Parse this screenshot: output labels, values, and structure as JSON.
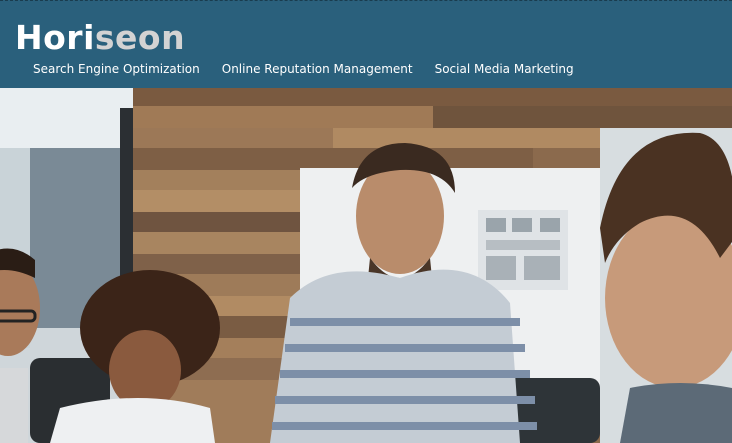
{
  "header": {
    "logo": {
      "part1": "Hori",
      "part2": "seon",
      "part2_color": "#d3d3d3"
    },
    "background_color": "#2a607c",
    "nav": [
      {
        "label": "Search Engine Optimization"
      },
      {
        "label": "Online Reputation Management"
      },
      {
        "label": "Social Media Marketing"
      }
    ]
  },
  "hero": {
    "description_icon": "team-meeting-photo"
  }
}
